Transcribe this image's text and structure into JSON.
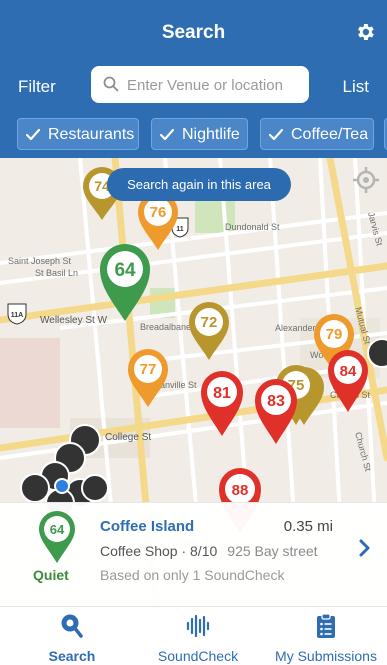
{
  "header": {
    "title": "Search"
  },
  "filter_label": "Filter",
  "list_label": "List",
  "search": {
    "placeholder": "Enter Venue or location"
  },
  "chips": [
    {
      "label": "Restaurants"
    },
    {
      "label": "Nightlife"
    },
    {
      "label": "Coffee/Tea"
    }
  ],
  "map": {
    "search_again": "Search again in this area",
    "street_labels": [
      "Dundonald St",
      "Saint Joseph St",
      "St Basil Ln",
      "Wellesley St W",
      "Breadalbane St",
      "Alexander St",
      "Wood St",
      "Granville St",
      "College St",
      "Church St",
      "Mutual St",
      "Jarvis St",
      "Carlton St"
    ],
    "highway_shields": [
      "11A",
      "11"
    ],
    "pins": [
      {
        "score": "74",
        "color": "#b8962e"
      },
      {
        "score": "76",
        "color": "#ef9a2c"
      },
      {
        "score": "64",
        "color": "#3e9a4d"
      },
      {
        "score": "72",
        "color": "#b8962e"
      },
      {
        "score": "79",
        "color": "#ef9a2c"
      },
      {
        "score": "77",
        "color": "#ef9a2c"
      },
      {
        "score": "81",
        "color": "#e0302a"
      },
      {
        "score": "75",
        "color": "#b8962e"
      },
      {
        "score": "83",
        "color": "#e0302a"
      },
      {
        "score": "84",
        "color": "#e0302a"
      },
      {
        "score": "88",
        "color": "#e0302a"
      }
    ]
  },
  "card": {
    "badge": "64",
    "name": "Coffee Island",
    "distance": "0.35 mi",
    "meta": "Coffee Shop · 8/10",
    "address": "925 Bay street",
    "note": "Based on only 1 SoundCheck",
    "level": "Quiet"
  },
  "tabs": [
    {
      "label": "Search",
      "icon": "search-tab-icon"
    },
    {
      "label": "SoundCheck",
      "icon": "soundwave-icon"
    },
    {
      "label": "My Submissions",
      "icon": "clipboard-list-icon"
    }
  ],
  "colors": {
    "brand": "#2f6db3",
    "green": "#3e9a4d",
    "gold": "#b8962e",
    "orange": "#ef9a2c",
    "red": "#e0302a"
  }
}
